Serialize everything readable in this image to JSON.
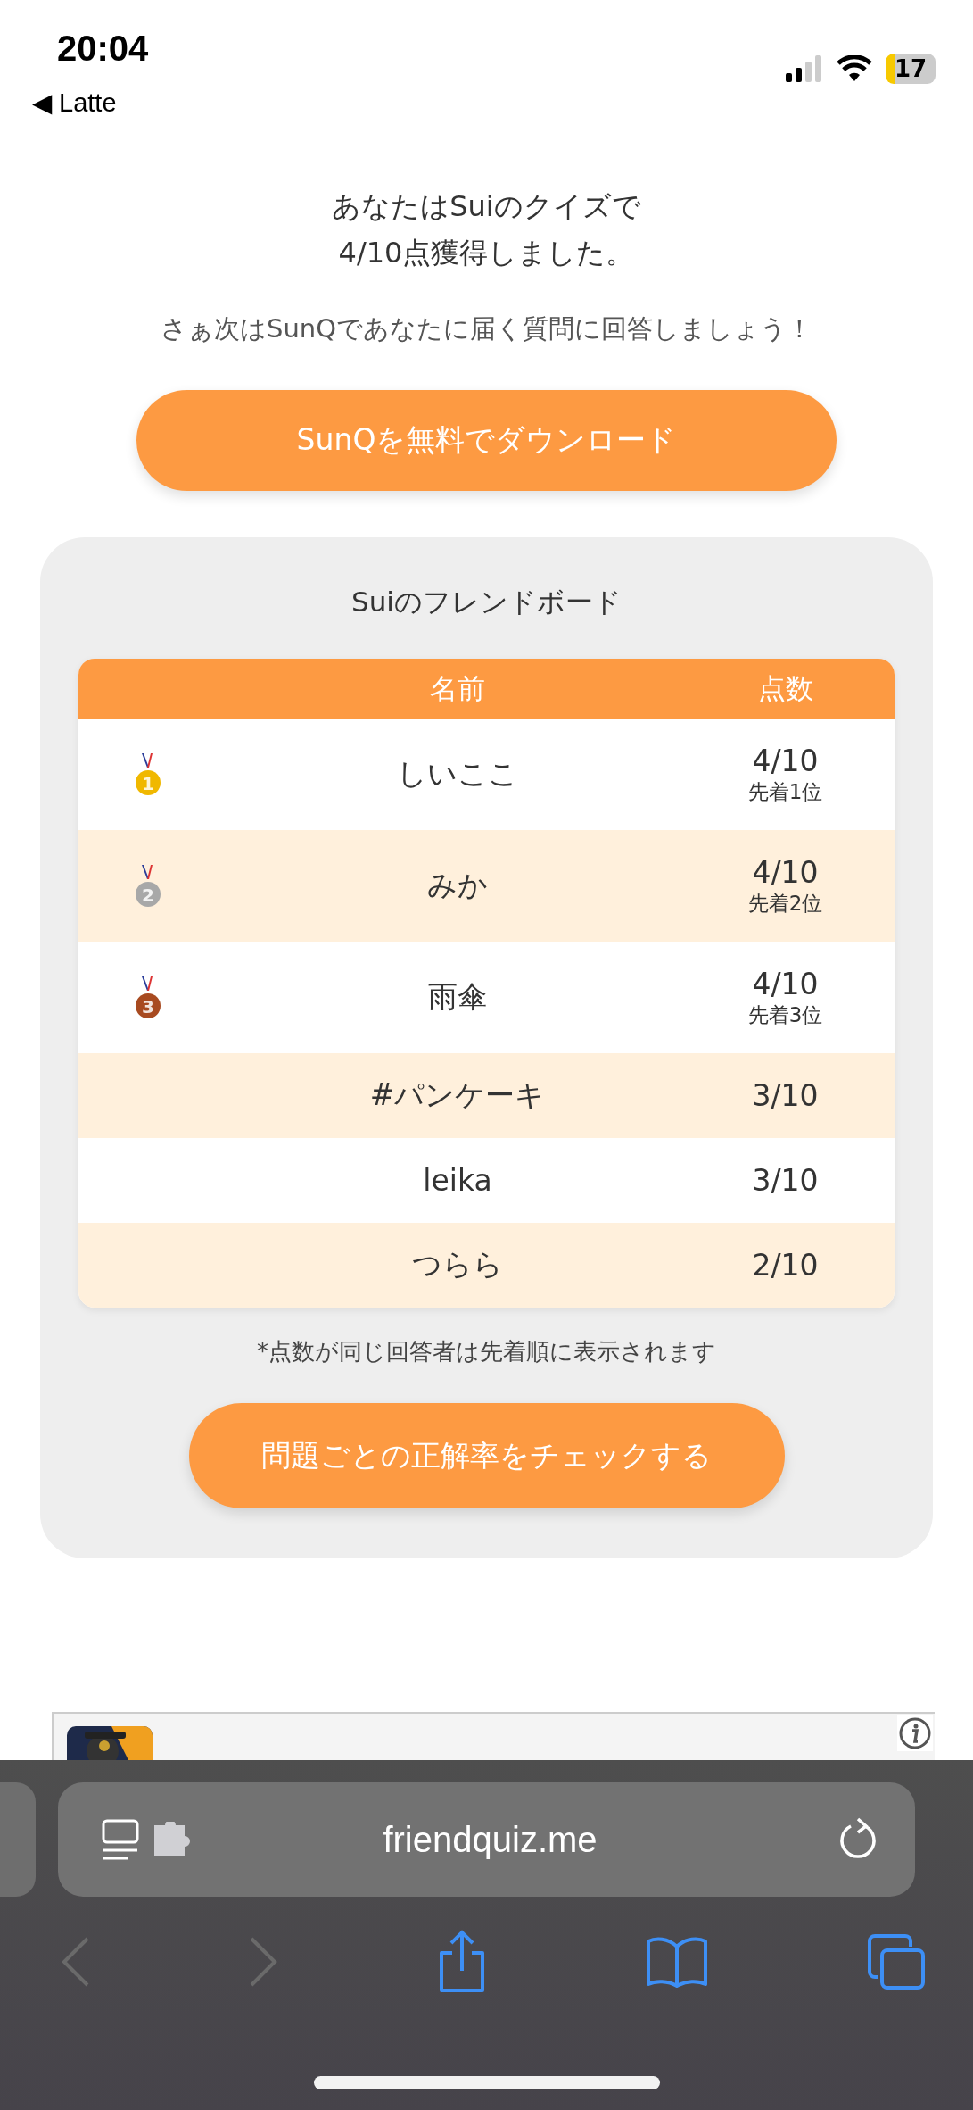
{
  "status_bar": {
    "time": "20:04",
    "back_app": "◀ Latte",
    "battery": "17"
  },
  "result": {
    "lines": [
      "あなたはSuiのクイズで",
      "4/10点獲得しました。"
    ],
    "prompt": "さぁ次はSunQであなたに届く質問に回答しましょう！"
  },
  "download_button": "SunQを無料でダウンロード",
  "leaderboard": {
    "title": "Suiのフレンドボード",
    "columns": [
      "名前",
      "点数"
    ],
    "rows": [
      {
        "medal": "1",
        "color": "#f0b800",
        "name": "しいここ",
        "score": "4/10",
        "rank": "先着1位"
      },
      {
        "medal": "2",
        "color": "#a8a8a8",
        "name": "みか",
        "score": "4/10",
        "rank": "先着2位"
      },
      {
        "medal": "3",
        "color": "#a84a20",
        "name": "雨傘",
        "score": "4/10",
        "rank": "先着3位"
      },
      {
        "name": "#パンケーキ",
        "score": "3/10"
      },
      {
        "name": "leika",
        "score": "3/10"
      },
      {
        "name": "つらら",
        "score": "2/10"
      }
    ],
    "note": "*点数が同じ回答者は先着順に表示されます",
    "check_button": "問題ごとの正解率をチェックする"
  },
  "browser": {
    "url": "friendquiz.me"
  }
}
